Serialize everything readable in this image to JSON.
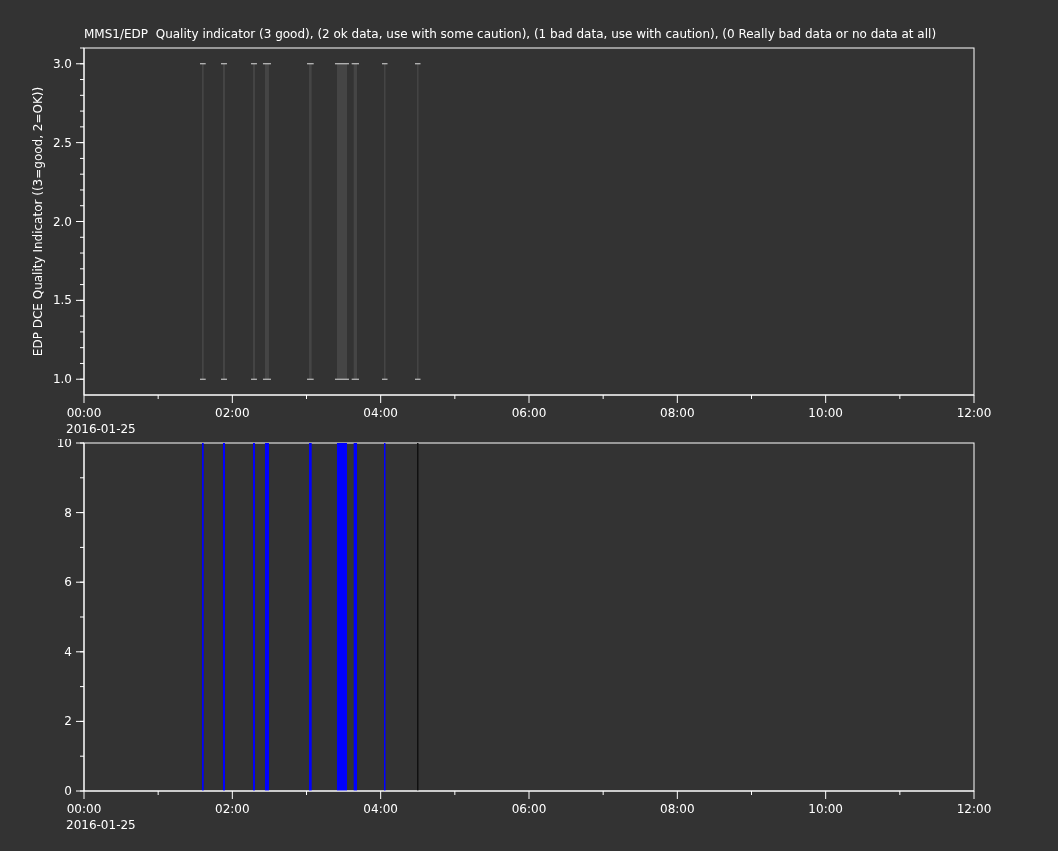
{
  "plots": [
    {
      "title": "MMS1/EDP  Quality indicator (3 good), (2 ok data, use with some caution), (1 bad data, use with caution), (0 Really bad data or no data at all)",
      "y_axis_title": "EDP DCE Quality Indicator ((3=good, 2=OK))",
      "x_tick_labels": [
        "00:00",
        "02:00",
        "04:00",
        "06:00",
        "08:00",
        "10:00",
        "12:00"
      ],
      "date_label": "2016-01-25",
      "y_tick_labels": [
        "3.0",
        "2.5",
        "2.0",
        "1.5",
        "1.0"
      ]
    },
    {
      "x_tick_labels": [
        "00:00",
        "02:00",
        "04:00",
        "06:00",
        "08:00",
        "10:00",
        "12:00"
      ],
      "date_label": "2016-01-25",
      "y_tick_labels": [
        "10",
        "8",
        "6",
        "4",
        "2",
        "0"
      ]
    }
  ]
}
